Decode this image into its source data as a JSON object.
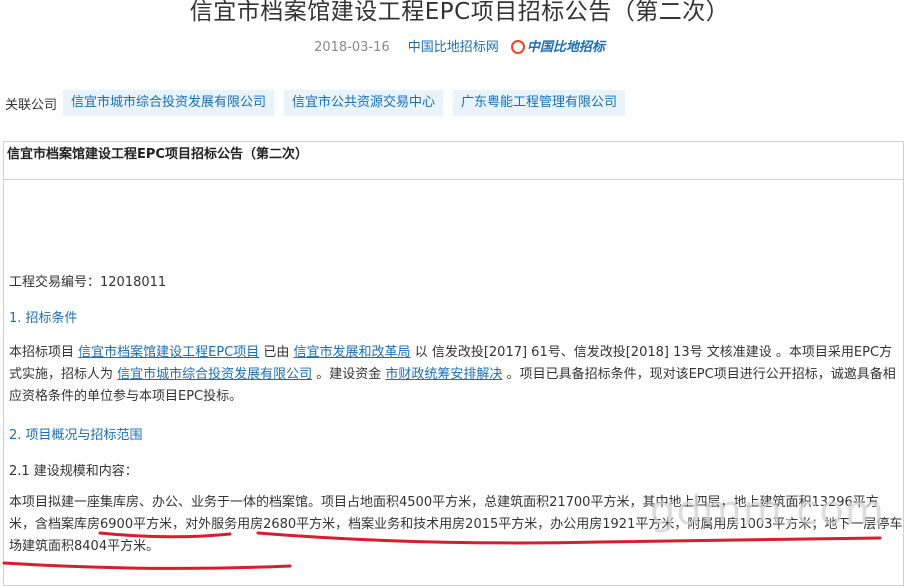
{
  "article": {
    "title": "信宜市档案馆建设工程EPC项目招标公告（第二次）",
    "date": "2018-03-16",
    "source": "中国比地招标网",
    "logo_text": "中国比地招标"
  },
  "related": {
    "label": "关联公司",
    "companies": [
      "信宜市城市综合投资发展有限公司",
      "信宜市公共资源交易中心",
      "广东粤能工程管理有限公司"
    ]
  },
  "content": {
    "header": "信宜市档案馆建设工程EPC项目招标公告（第二次）",
    "trade_no": "工程交易编号：12018011",
    "section1": "1. 招标条件",
    "s1": {
      "t1": "本招标项目 ",
      "l1": "信宜市档案馆建设工程EPC项目",
      "t2": " 已由 ",
      "l2": "信宜市发展和改革局",
      "t3": " 以 信发改投[2017] 61号、信发改投[2018] 13号 文核准建设 。本项目采用EPC方式实施，招标人为 ",
      "l3": "信宜市城市综合投资发展有限公司",
      "t4": " 。建设资金 ",
      "l4": "市财政统筹安排解决",
      "t5": " 。项目已具备招标条件，现对该EPC项目进行公开招标，诚邀具备相应资格条件的单位参与本项目EPC投标。"
    },
    "section2": "2. 项目概况与招标范围",
    "section21": "2.1 建设规模和内容：",
    "scale_text": "本项目拟建一座集库房、办公、业务于一体的档案馆。项目占地面积4500平方米，总建筑面积21700平方米，其中地上四层，地上建筑面积13296平方米，含档案库房6900平方米，对外服务用房2680平方米，档案业务和技术用房2015平方米，办公用房1921平方米，附属用房1003平方米；地下一层停车场建筑面积8404平方米。",
    "watermark": "gdmm.com"
  },
  "colors": {
    "link": "#1a6fb5",
    "tag_bg": "#e8f3fb",
    "annotation": "#d81e2c"
  }
}
